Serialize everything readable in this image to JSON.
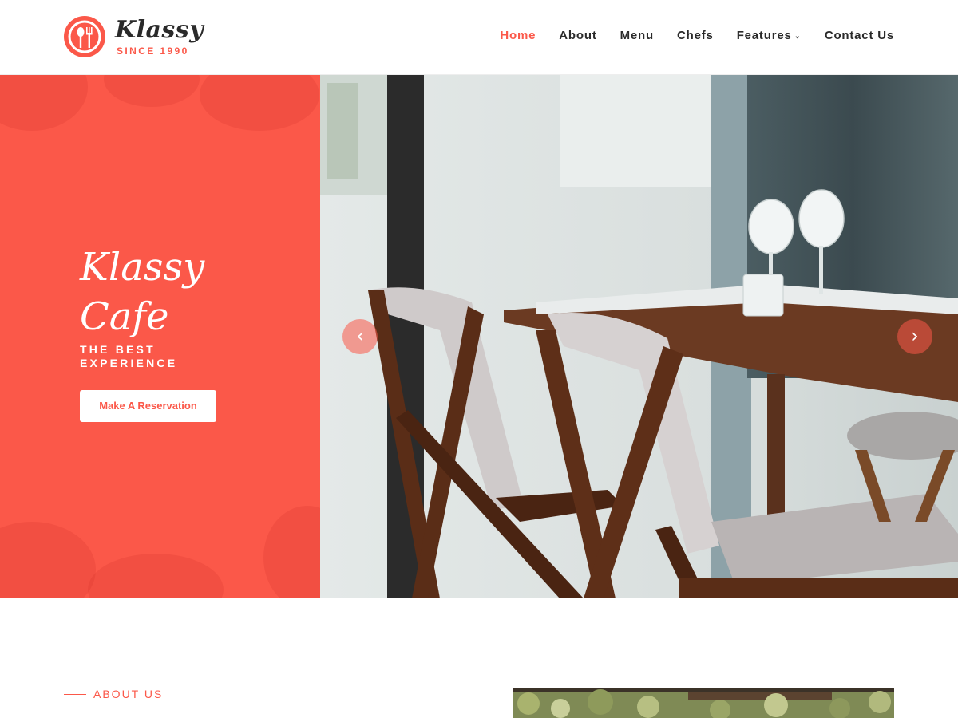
{
  "brand": {
    "name": "Klassy",
    "tagline": "SINCE 1990",
    "accent_color": "#fb5849"
  },
  "nav": {
    "items": [
      {
        "label": "Home",
        "active": true
      },
      {
        "label": "About",
        "active": false
      },
      {
        "label": "Menu",
        "active": false
      },
      {
        "label": "Chefs",
        "active": false
      },
      {
        "label": "Features",
        "active": false,
        "dropdown": true
      },
      {
        "label": "Contact Us",
        "active": false
      }
    ]
  },
  "hero": {
    "title_line1": "Klassy",
    "title_line2": "Cafe",
    "subtitle_line1": "THE BEST",
    "subtitle_line2": "EXPERIENCE",
    "button_label": "Make A Reservation",
    "prev_icon": "‹",
    "next_icon": "›"
  },
  "about": {
    "label": "ABOUT US"
  }
}
